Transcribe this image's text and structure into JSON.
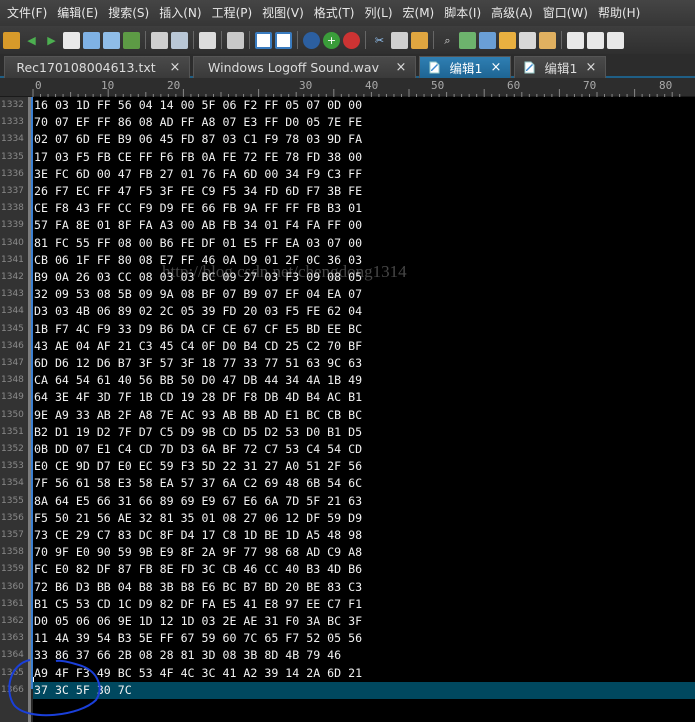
{
  "menu": [
    "文件(F)",
    "编辑(E)",
    "搜索(S)",
    "插入(N)",
    "工程(P)",
    "视图(V)",
    "格式(T)",
    "列(L)",
    "宏(M)",
    "脚本(I)",
    "高级(A)",
    "窗口(W)",
    "帮助(H)"
  ],
  "tabs": [
    {
      "label": "Rec170108004613.txt",
      "active": false
    },
    {
      "label": "Windows Logoff Sound.wav",
      "active": false
    },
    {
      "label": "编辑1",
      "active": true
    },
    {
      "label": "编辑1",
      "active": false
    }
  ],
  "ruler": [
    "0",
    "10",
    "20",
    "30",
    "40",
    "50",
    "60",
    "70",
    "80"
  ],
  "line_numbers": [
    "1332",
    "1333",
    "1334",
    "1335",
    "1336",
    "1337",
    "1338",
    "1339",
    "1340",
    "1341",
    "1342",
    "1343",
    "1344",
    "1345",
    "1346",
    "1347",
    "1348",
    "1349",
    "1350",
    "1351",
    "1352",
    "1353",
    "1354",
    "1355",
    "1356",
    "1357",
    "1358",
    "1359",
    "1360",
    "1361",
    "1362",
    "1363",
    "1364",
    "1365",
    "1366"
  ],
  "lines": [
    "16 03 1D FF 56 04 14 00 5F 06 F2 FF 05 07 0D 00",
    "70 07 EF FF 86 08 AD FF A8 07 E3 FF D0 05 7E FE",
    "02 07 6D FE B9 06 45 FD 87 03 C1 F9 78 03 9D FA",
    "17 03 F5 FB CE FF F6 FB 0A FE 72 FE 78 FD 38 00",
    "3E FC 6D 00 47 FB 27 01 76 FA 6D 00 34 F9 C3 FF",
    "26 F7 EC FF 47 F5 3F FE C9 F5 34 FD 6D F7 3B FE",
    "CE F8 43 FF CC F9 D9 FE 66 FB 9A FF FF FB B3 01",
    "57 FA 8E 01 8F FA A3 00 AB FB 34 01 F4 FA FF 00",
    "81 FC 55 FF 08 00 B6 FE DF 01 E5 FF EA 03 07 00",
    "CB 06 1F FF 80 08 E7 FF 46 0A D9 01 2F 0C 36 03",
    "B9 0A 26 03 CC 08 03 03 BC 09 27 03 F3 09 08 05",
    "32 09 53 08 5B 09 9A 08 BF 07 B9 07 EF 04 EA 07",
    "D3 03 4B 06 89 02 2C 05 39 FD 20 03 F5 FE 62 04",
    "1B F7 4C F9 33 D9 B6 DA CF CE 67 CF E5 BD EE BC",
    "43 AE 04 AF 21 C3 45 C4 0F D0 B4 CD 25 C2 70 BF",
    "6D D6 12 D6 B7 3F 57 3F 18 77 33 77 51 63 9C 63",
    "CA 64 54 61 40 56 BB 50 D0 47 DB 44 34 4A 1B 49",
    "64 3E 4F 3D 7F 1B CD 19 28 DF F8 DB 4D B4 AC B1",
    "9E A9 33 AB 2F A8 7E AC 93 AB BB AD E1 BC CB BC",
    "B2 D1 19 D2 7F D7 C5 D9 9B CD D5 D2 53 D0 B1 D5",
    "0B DD 07 E1 C4 CD 7D D3 6A BF 72 C7 53 C4 54 CD",
    "E0 CE 9D D7 E0 EC 59 F3 5D 22 31 27 A0 51 2F 56",
    "7F 56 61 58 E3 58 EA 57 37 6A C2 69 48 6B 54 6C",
    "8A 64 E5 66 31 66 89 69 E9 67 E6 6A 7D 5F 21 63",
    "F5 50 21 56 AE 32 81 35 01 08 27 06 12 DF 59 D9",
    "73 CE 29 C7 83 DC 8F D4 17 C8 1D BE 1D A5 48 98",
    "70 9F E0 90 59 9B E9 8F 2A 9F 77 98 68 AD C9 A8",
    "FC E0 82 DF 87 FB 8E FD 3C CB 46 CC 40 B3 4D B6",
    "72 B6 D3 BB 04 B8 3B B8 E6 BC B7 BD 20 BE 83 C3",
    "B1 C5 53 CD 1C D9 82 DF FA E5 41 E8 97 EE C7 F1",
    "D0 05 06 06 9E 1D 12 1D 03 2E AE 31 F0 3A BC 3F",
    "11 4A 39 54 B3 5E FF 67 59 60 7C 65 F7 52 05 56",
    "33 86 37 66 2B 08 28 81 3D 08 3B 8D 4B 79 46",
    "A9 4F F3 49 BC 53 4F 4C 3C 41 A2 39 14 2A 6D 21",
    "37 3C 5F 30 7C"
  ],
  "current_line_index": 34,
  "watermark": "http://blog.csdn.net/chengdong1314",
  "colors": {
    "accent": "#2f7fb3",
    "current_line": "#00485f",
    "editor_bg": "#000000",
    "annotation": "#1a3fd9"
  }
}
